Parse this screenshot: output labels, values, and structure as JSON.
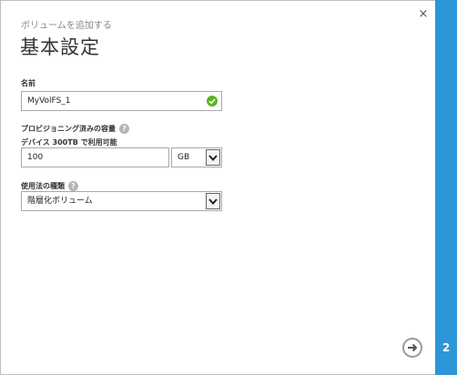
{
  "dialog": {
    "subtitle": "ボリュームを追加する",
    "title": "基本設定",
    "close_glyph": "×"
  },
  "form": {
    "name": {
      "label": "名前",
      "value": "MyVolFS_1",
      "valid": true
    },
    "capacity": {
      "label": "プロビジョニング済みの容量",
      "help_glyph": "?",
      "sublabel": "デバイス 300TB で利用可能",
      "value": "100",
      "unit": "GB"
    },
    "usage_type": {
      "label": "使用法の種類",
      "help_glyph": "?",
      "value": "階層化ボリューム"
    }
  },
  "wizard": {
    "step": "2"
  },
  "colors": {
    "sidebar": "#2c96d6",
    "valid_check": "#5bb61f"
  }
}
